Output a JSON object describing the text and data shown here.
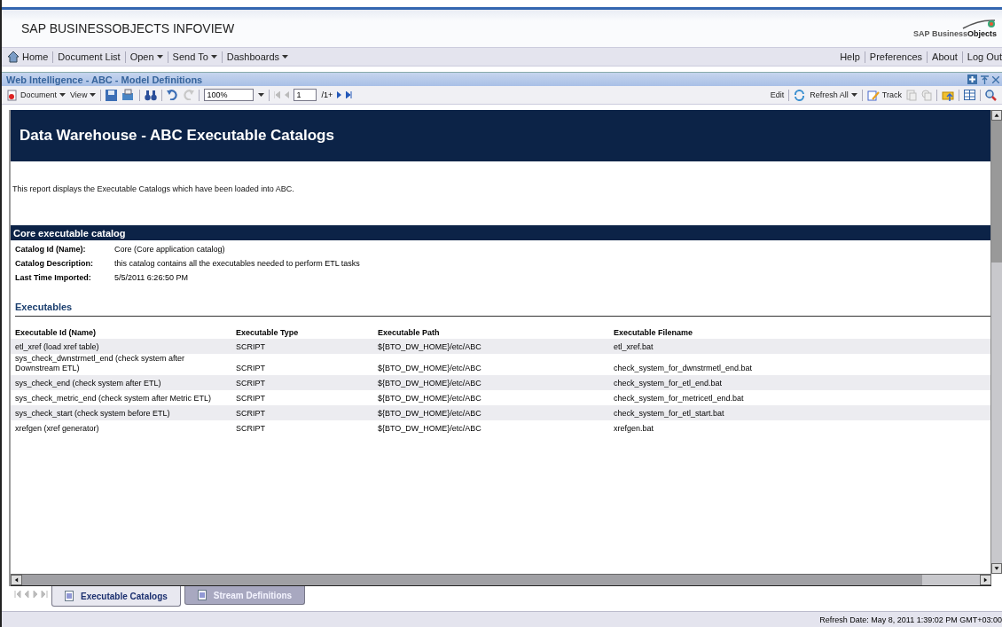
{
  "banner": {
    "title": "SAP BUSINESSOBJECTS INFOVIEW",
    "logo_text": "SAP Business",
    "logo_bold": "Objects"
  },
  "nav": {
    "left": [
      {
        "label": "Home",
        "icon": true,
        "menu": false
      },
      {
        "label": "Document List",
        "icon": false,
        "menu": false
      },
      {
        "label": "Open",
        "icon": false,
        "menu": true
      },
      {
        "label": "Send To",
        "icon": false,
        "menu": true
      },
      {
        "label": "Dashboards",
        "icon": false,
        "menu": true
      }
    ],
    "right": [
      "Help",
      "Preferences",
      "About",
      "Log Out"
    ]
  },
  "window": {
    "title": "Web Intelligence - ABC - Model Definitions"
  },
  "toolbar": {
    "document": "Document",
    "view": "View",
    "zoom": "100%",
    "page": "1",
    "page_total": "/1+",
    "edit": "Edit",
    "refresh": "Refresh All",
    "track": "Track"
  },
  "report": {
    "title": "Data Warehouse - ABC Executable Catalogs",
    "intro": "This report displays the Executable Catalogs which have been loaded into ABC.",
    "section_title": "Core executable catalog",
    "fields": [
      {
        "label": "Catalog Id (Name):",
        "value": "Core (Core application catalog)"
      },
      {
        "label": "Catalog Description:",
        "value": "this catalog contains all the executables needed to perform ETL tasks"
      },
      {
        "label": "Last Time Imported:",
        "value": "5/5/2011 6:26:50 PM"
      }
    ],
    "table_title": "Executables",
    "columns": [
      "Executable Id (Name)",
      "Executable Type",
      "Executable Path",
      "Executable Filename"
    ],
    "rows": [
      [
        "etl_xref (load xref table)",
        "SCRIPT",
        "${BTO_DW_HOME}/etc/ABC",
        "etl_xref.bat"
      ],
      [
        "sys_check_dwnstrmetl_end (check system after Downstream ETL)",
        "SCRIPT",
        "${BTO_DW_HOME}/etc/ABC",
        "check_system_for_dwnstrmetl_end.bat"
      ],
      [
        "sys_check_end (check system after ETL)",
        "SCRIPT",
        "${BTO_DW_HOME}/etc/ABC",
        "check_system_for_etl_end.bat"
      ],
      [
        "sys_check_metric_end (check system after Metric ETL)",
        "SCRIPT",
        "${BTO_DW_HOME}/etc/ABC",
        "check_system_for_metricetl_end.bat"
      ],
      [
        "sys_check_start (check system before ETL)",
        "SCRIPT",
        "${BTO_DW_HOME}/etc/ABC",
        "check_system_for_etl_start.bat"
      ],
      [
        "xrefgen (xref generator)",
        "SCRIPT",
        "${BTO_DW_HOME}/etc/ABC",
        "xrefgen.bat"
      ]
    ]
  },
  "tabs": [
    {
      "label": "Executable Catalogs",
      "selected": true
    },
    {
      "label": "Stream Definitions",
      "selected": false
    }
  ],
  "status_bar": "Refresh Date: May 8, 2011 1:39:02 PM GMT+03:00"
}
